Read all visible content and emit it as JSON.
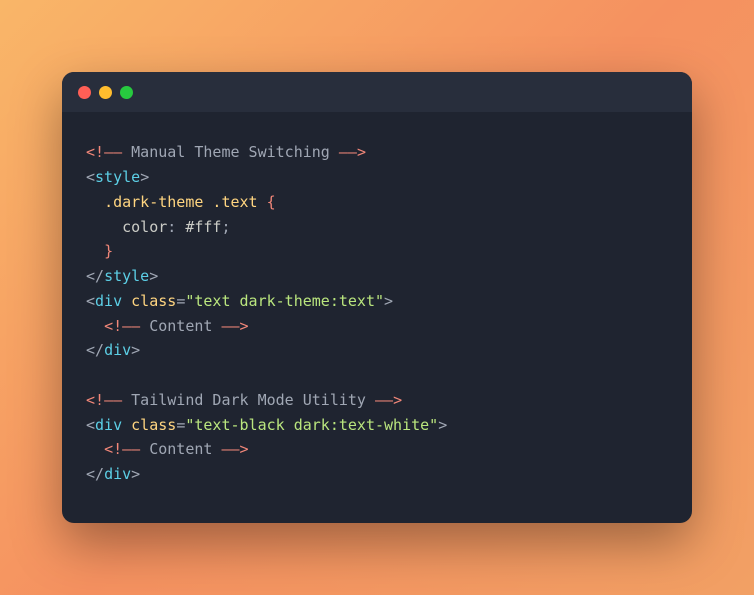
{
  "code": {
    "comment1": " Manual Theme Switching ",
    "styleOpen": "style",
    "selector": ".dark-theme .text",
    "braceOpen": "{",
    "prop": "color",
    "colon": ":",
    "val": " #fff",
    "semi": ";",
    "braceClose": "}",
    "styleClose": "style",
    "divTag": "div",
    "classAttr": "class",
    "classVal1": "\"text dark-theme:text\"",
    "contentComment": " Content ",
    "comment2": " Tailwind Dark Mode Utility ",
    "classVal2": "\"text-black dark:text-white\"",
    "lt": "<",
    "gt": ">",
    "slash": "/",
    "bang": "!",
    "dashdash": "——",
    "eq": "="
  }
}
